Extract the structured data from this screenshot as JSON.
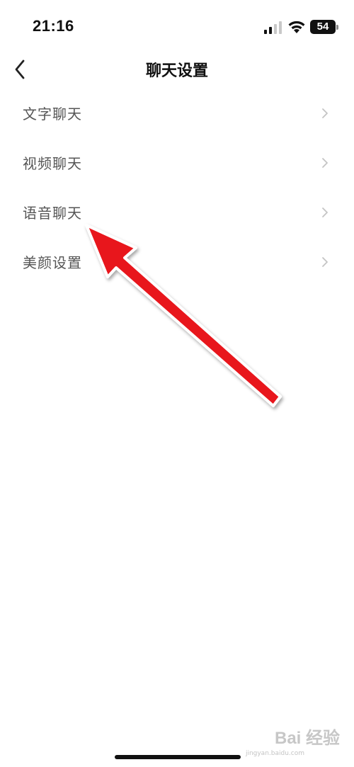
{
  "status_bar": {
    "time": "21:16",
    "battery_level": "54",
    "icons": [
      "signal-icon",
      "wifi-icon",
      "battery-icon"
    ]
  },
  "nav": {
    "title": "聊天设置",
    "back_icon": "chevron-left-icon"
  },
  "settings_list": {
    "items": [
      {
        "label": "文字聊天",
        "icon": "chevron-right-icon"
      },
      {
        "label": "视频聊天",
        "icon": "chevron-right-icon"
      },
      {
        "label": "语音聊天",
        "icon": "chevron-right-icon"
      },
      {
        "label": "美颜设置",
        "icon": "chevron-right-icon"
      }
    ]
  },
  "annotation": {
    "color": "#e8141c",
    "icon": "red-arrow-annotation"
  },
  "watermark": {
    "text": "Bai 经验",
    "sub": "jingyan.baidu.com"
  },
  "colors": {
    "background": "#ffffff",
    "text_primary": "#111111",
    "text_secondary": "#555555",
    "chevron": "#c4c4c4"
  }
}
